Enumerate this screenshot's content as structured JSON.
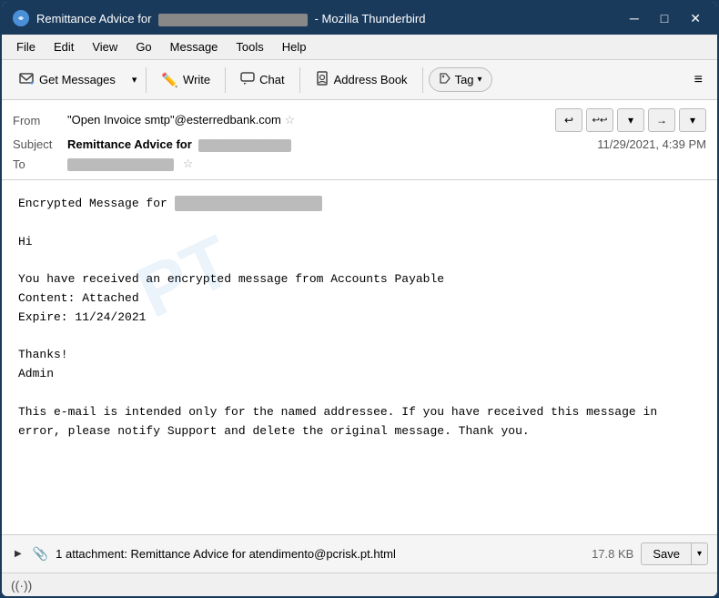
{
  "window": {
    "title": "Remittance Advice for",
    "title_suffix": " - Mozilla Thunderbird",
    "title_blurred": "████████████████████",
    "icon": "TB"
  },
  "menu": {
    "items": [
      "File",
      "Edit",
      "View",
      "Go",
      "Message",
      "Tools",
      "Help"
    ]
  },
  "toolbar": {
    "get_messages_label": "Get Messages",
    "write_label": "Write",
    "chat_label": "Chat",
    "address_book_label": "Address Book",
    "tag_label": "Tag",
    "hamburger": "≡"
  },
  "email_header": {
    "from_label": "From",
    "from_value": "\"Open Invoice smtp\"@esterredbank.com",
    "subject_label": "Subject",
    "subject_prefix": "Remittance Advice for",
    "subject_blurred": "████████████████████",
    "date": "11/29/2021, 4:39 PM",
    "to_label": "To",
    "to_blurred": "██████████████████"
  },
  "email_body": {
    "encrypted_label": "Encrypted Message for",
    "encrypted_email_blurred": "████████████████████",
    "greeting": "Hi",
    "line1": "You have received an encrypted message from Accounts Payable",
    "line2": "Content: Attached",
    "line3": "Expire: 11/24/2021",
    "sign_off": "Thanks!",
    "admin": "Admin",
    "disclaimer": "This e-mail is intended only for the named addressee. If you have received this message in error, please notify  Support and delete the original message. Thank you."
  },
  "attachment": {
    "count_text": "1 attachment: Remittance Advice for atendimento@pcrisk.pt.html",
    "size": "17.8 KB",
    "save_label": "Save"
  },
  "status_bar": {
    "icon": "((·))"
  },
  "actions": {
    "reply": "↩",
    "reply_all": "↩↩",
    "chevron_down": "▾",
    "forward": "→",
    "more": "▾"
  }
}
